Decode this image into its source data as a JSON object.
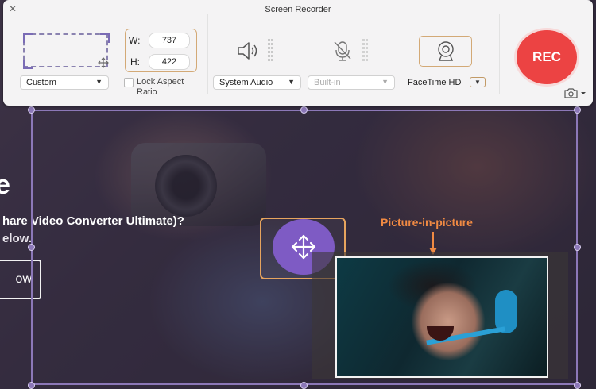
{
  "window": {
    "title": "Screen Recorder"
  },
  "area": {
    "preset": "Custom",
    "width_label": "W:",
    "width_value": "737",
    "height_label": "H:",
    "height_value": "422",
    "lock_aspect_label": "Lock Aspect Ratio",
    "lock_aspect_checked": false
  },
  "audio": {
    "system_audio": "System Audio",
    "microphone": "Built-in"
  },
  "webcam": {
    "device": "FaceTime HD"
  },
  "record": {
    "label": "REC"
  },
  "page": {
    "big_letter": "e",
    "line1": "hare Video Converter Ultimate)?",
    "line2": "elow.",
    "button": "ow"
  },
  "annotation": {
    "pip_label": "Picture-in-picture"
  },
  "colors": {
    "accent_purple": "#8c78b8",
    "move_fill": "#7e5bc4",
    "highlight_orange": "#e6a45e",
    "rec_red": "#ec4343",
    "pip_label": "#f08a43"
  },
  "icons": {
    "close": "close-icon",
    "move": "move-arrows-icon",
    "speaker": "speaker-icon",
    "mic_off": "microphone-off-icon",
    "webcam": "webcam-icon",
    "camera": "camera-icon"
  }
}
